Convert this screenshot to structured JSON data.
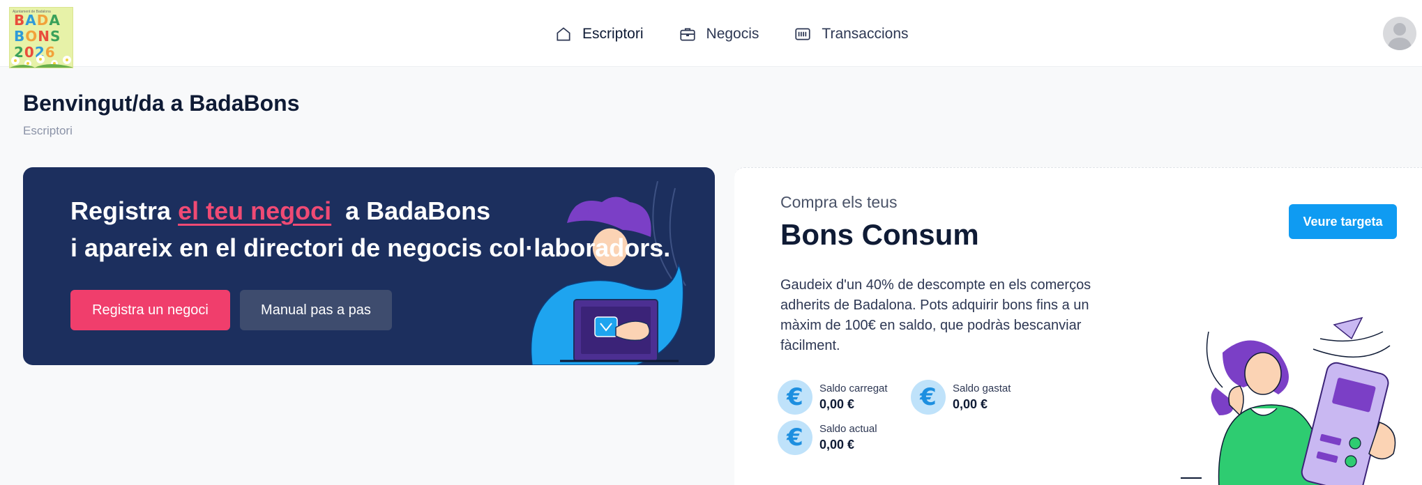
{
  "logo": {
    "tagline": "Ajuntament de Badalona",
    "line1": [
      "B",
      "A",
      "D",
      "A"
    ],
    "line2": [
      "B",
      "O",
      "N",
      "S"
    ],
    "line3": [
      "2",
      "0",
      "2",
      "6"
    ],
    "colors": [
      "#e94d3c",
      "#2f9ad8",
      "#f2a23a",
      "#3aa15a"
    ]
  },
  "nav": {
    "items": [
      {
        "label": "Escriptori",
        "icon": "home-icon"
      },
      {
        "label": "Negocis",
        "icon": "briefcase-icon"
      },
      {
        "label": "Transaccions",
        "icon": "receipt-icon"
      }
    ]
  },
  "page": {
    "title": "Benvingut/da a BadaBons",
    "breadcrumb": "Escriptori"
  },
  "hero": {
    "prefix": "Registra ",
    "highlight": "el teu negoci",
    "suffix": "  a BadaBons",
    "line2": "i apareix en el directori de negocis col·laboradors.",
    "primary_button": "Registra un negoci",
    "secondary_button": "Manual pas a pas"
  },
  "bons": {
    "kicker": "Compra els teus",
    "title": "Bons Consum",
    "card_button": "Veure targeta",
    "description": "Gaudeix d'un 40% de descompte en els comerços adherits de Badalona. Pots adquirir bons fins a un màxim de 100€ en saldo, que podràs bescanviar fàcilment.",
    "stats": [
      {
        "label": "Saldo carregat",
        "value": "0,00 €"
      },
      {
        "label": "Saldo gastat",
        "value": "0,00 €"
      },
      {
        "label": "Saldo actual",
        "value": "0,00 €"
      }
    ],
    "currency_symbol": "€"
  },
  "colors": {
    "navy": "#1c2f5e",
    "pink": "#f03e6c",
    "blue": "#0f9bf2"
  }
}
